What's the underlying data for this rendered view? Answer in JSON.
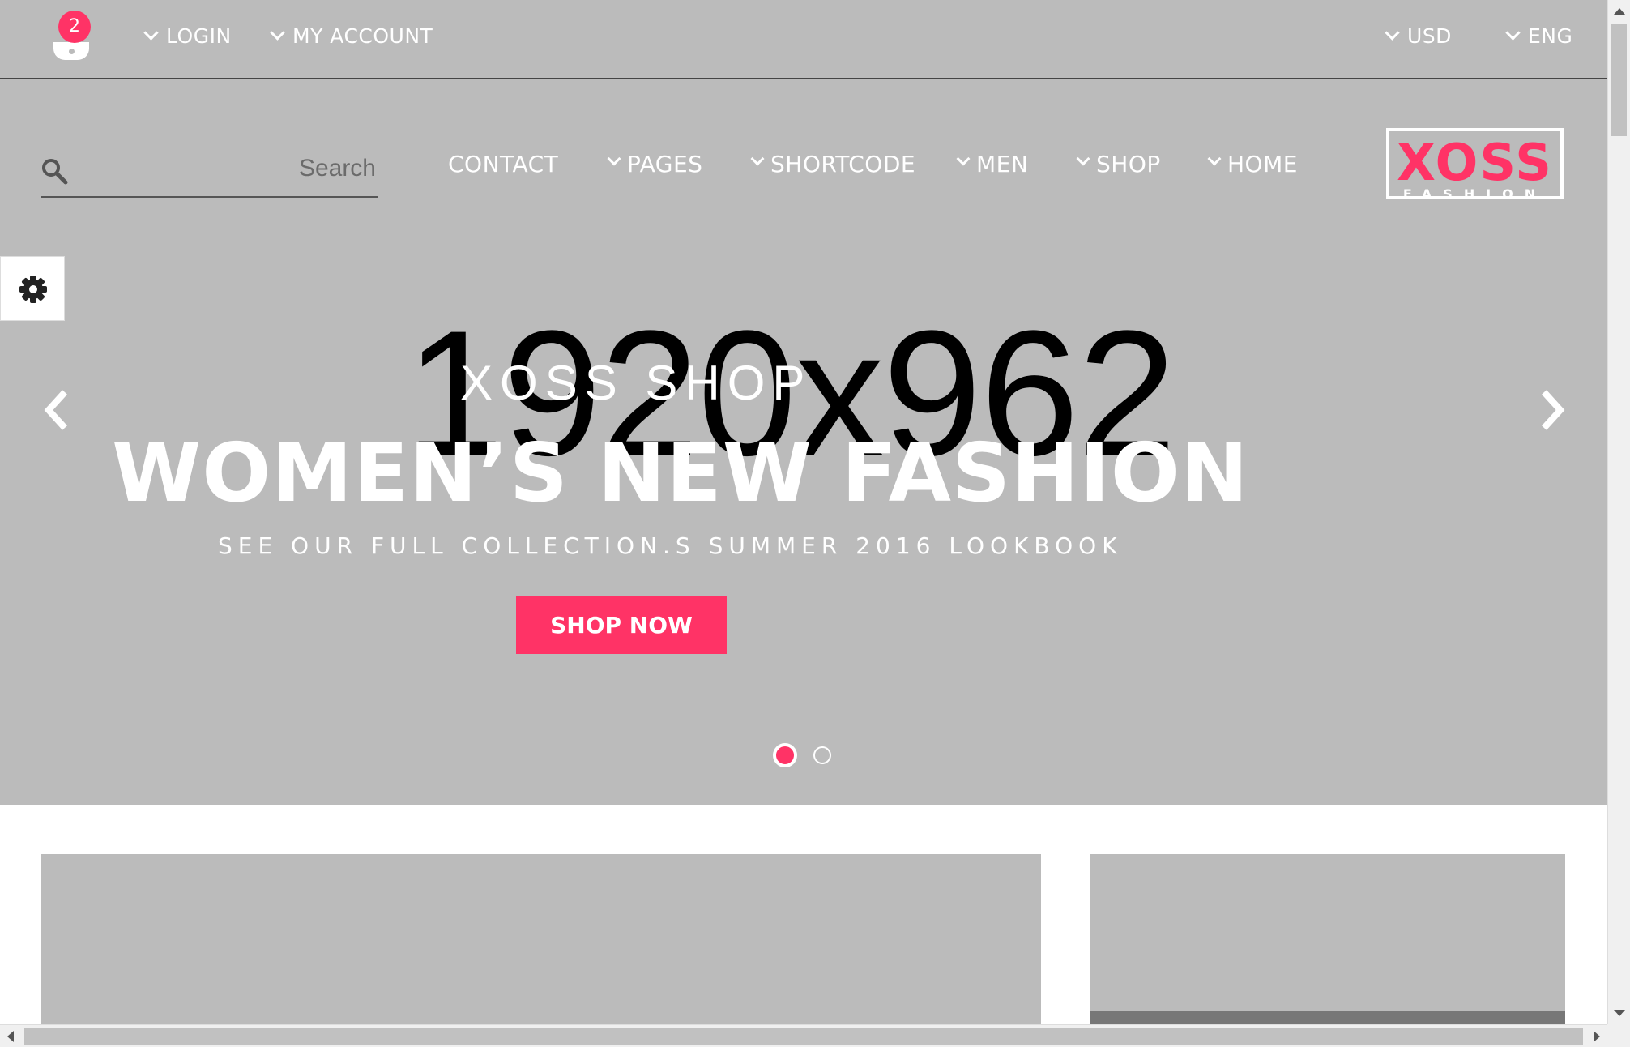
{
  "topbar": {
    "cart_count": "2",
    "login_label": "LOGIN",
    "account_label": "MY ACCOUNT",
    "currency_label": "USD",
    "language_label": "ENG"
  },
  "search": {
    "placeholder": "Search"
  },
  "nav": {
    "contact": "CONTACT",
    "pages": "PAGES",
    "shortcode": "SHORTCODE",
    "men": "MEN",
    "shop": "SHOP",
    "home": "HOME"
  },
  "logo": {
    "main": "XOSS",
    "sub": "FASHION"
  },
  "hero": {
    "placeholder_text": "1920x962",
    "kicker": "XOSS SHOP",
    "title": "WOMEN’S NEW FASHION",
    "subtitle": "SEE OUR FULL COLLECTION.S SUMMER 2016 LOOKBOOK",
    "cta_label": "SHOP NOW",
    "active_slide": 1,
    "slide_count": 2
  },
  "colors": {
    "accent": "#ff3366",
    "hero_bg": "#bbbbbb",
    "text_light": "#ffffff"
  },
  "icons": {
    "cart": "shopping-basket-icon",
    "search": "search-icon",
    "settings": "gear-icon",
    "prev": "chevron-left-icon",
    "next": "chevron-right-icon"
  }
}
